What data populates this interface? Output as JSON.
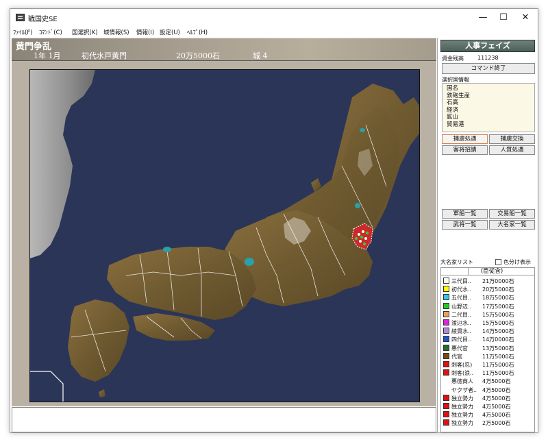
{
  "window": {
    "title": "戦国史SE",
    "min": "—",
    "max": "☐",
    "close": "✕"
  },
  "menu": [
    "ﾌｧｲﾙ(F)",
    "ｺﾏﾝﾄﾞ(C)",
    "国選択(K)",
    "城情報(S)",
    "情報(I)",
    "設定(U)",
    "ﾍﾙﾌﾟ(H)"
  ],
  "banner": {
    "scenario": "黄門争乱",
    "date": "1年  1月",
    "lord": "初代水戸黄門",
    "koku": "20万5000石",
    "castles": "城  4"
  },
  "side": {
    "phase": "人事フェイズ",
    "funds_label": "資金残高",
    "funds_value": "111238",
    "end_command": "コマンド終了",
    "selected_info_label": "選択国情報",
    "info_items": [
      "国名",
      "鉄砲生産",
      "石高",
      "経済",
      "鉱山",
      "貿易港"
    ],
    "buttons": {
      "b1": "捕虜処遇",
      "b2": "捕虜交換",
      "b3": "客将招請",
      "b4": "人質処遇",
      "b5": "軍船一覧",
      "b6": "交易船一覧",
      "b7": "武将一覧",
      "b8": "大名家一覧"
    },
    "list_label": "大名家リスト",
    "color_toggle": "色分け表示",
    "col_header": "(臣従含)"
  },
  "daimyo_list": [
    {
      "name": "三代目..",
      "koku": "21万0000石",
      "color": "#ffffff"
    },
    {
      "name": "初代水..",
      "koku": "20万5000石",
      "color": "#ffff00"
    },
    {
      "name": "五代目..",
      "koku": "18万5000石",
      "color": "#33ccdd"
    },
    {
      "name": "山野辺..",
      "koku": "17万5000石",
      "color": "#22cc22"
    },
    {
      "name": "二代目..",
      "koku": "15万5000石",
      "color": "#e6a060"
    },
    {
      "name": "渡辺水..",
      "koku": "15万5000石",
      "color": "#dd22dd"
    },
    {
      "name": "綾貫水..",
      "koku": "14万5000石",
      "color": "#b088dd"
    },
    {
      "name": "四代目..",
      "koku": "14万0000石",
      "color": "#2255cc"
    },
    {
      "name": "悪代官",
      "koku": "13万5000石",
      "color": "#2a6a2a"
    },
    {
      "name": "代官",
      "koku": "11万5000石",
      "color": "#7a4a10"
    },
    {
      "name": "刺客(忍)",
      "koku": "11万5000石",
      "color": "#dd1111"
    },
    {
      "name": "刺客(浪..",
      "koku": "11万5000石",
      "color": "#dd1111"
    },
    {
      "name": "悪徳商人",
      "koku": "4万5000石",
      "color": ""
    },
    {
      "name": "ヤクザ者..",
      "koku": "4万5000石",
      "color": ""
    },
    {
      "name": "独立勢力",
      "koku": "4万5000石",
      "color": "#dd1111"
    },
    {
      "name": "独立勢力",
      "koku": "4万5000石",
      "color": "#dd1111"
    },
    {
      "name": "独立勢力",
      "koku": "4万5000石",
      "color": "#dd1111"
    },
    {
      "name": "独立勢力",
      "koku": "2万5000石",
      "color": "#dd1111"
    }
  ]
}
